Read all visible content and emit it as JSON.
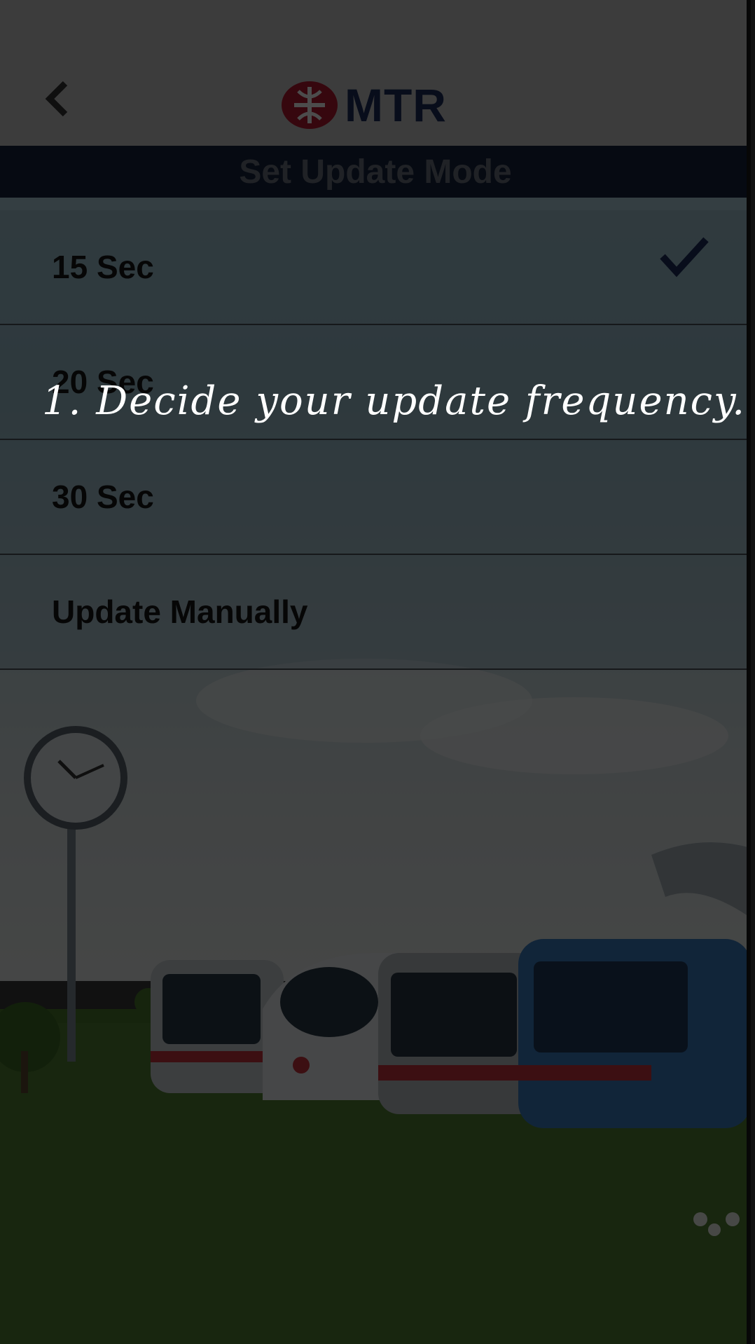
{
  "header": {
    "back_icon": "chevron-left-icon",
    "logo_text": "MTR"
  },
  "title": "Set Update Mode",
  "options": [
    {
      "label": "15 Sec",
      "selected": true
    },
    {
      "label": "20 Sec",
      "selected": false
    },
    {
      "label": "30 Sec",
      "selected": false
    },
    {
      "label": "Update Manually",
      "selected": false
    }
  ],
  "tutorial": {
    "hint": "1. Decide your update frequency."
  },
  "colors": {
    "title_bar": "#16233d",
    "brand_red": "#b5192f",
    "brand_navy": "#1b2d5a",
    "check": "#1b2d5a"
  }
}
